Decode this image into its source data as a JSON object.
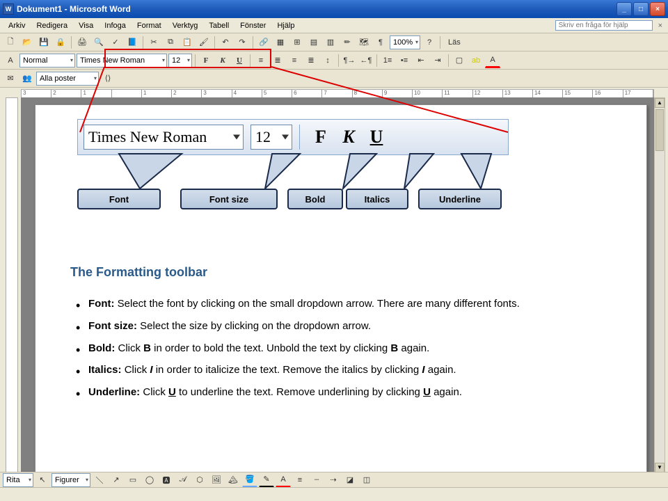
{
  "titlebar": {
    "title": "Dokument1 - Microsoft Word"
  },
  "menubar": {
    "items": [
      "Arkiv",
      "Redigera",
      "Visa",
      "Infoga",
      "Format",
      "Verktyg",
      "Tabell",
      "Fönster",
      "Hjälp"
    ],
    "help_placeholder": "Skriv en fråga för hjälp"
  },
  "toolbar_std": {
    "zoom": "100%",
    "read_label": "Läs"
  },
  "toolbar_fmt": {
    "style": "Normal",
    "font": "Times New Roman",
    "size": "12",
    "bold": "F",
    "italic": "K",
    "underline": "U"
  },
  "toolbar_mail": {
    "label": "Alla poster"
  },
  "ruler": {
    "marks": [
      "3",
      "2",
      "1",
      "",
      "1",
      "2",
      "3",
      "4",
      "5",
      "6",
      "7",
      "8",
      "9",
      "10",
      "11",
      "12",
      "13",
      "14",
      "15",
      "16",
      "17"
    ]
  },
  "enlarged": {
    "font": "Times New Roman",
    "size": "12",
    "bold": "F",
    "italic": "K",
    "underline": "U"
  },
  "callouts": {
    "font": "Font",
    "size": "Font size",
    "bold": "Bold",
    "italic": "Italics",
    "underline": "Underline"
  },
  "doc": {
    "heading": "The Formatting toolbar",
    "items": [
      {
        "term": "Font:",
        "text": " Select the font by clicking on the small dropdown arrow. There are many different fonts."
      },
      {
        "term": "Font size:",
        "text": " Select the size by clicking on the dropdown arrow."
      },
      {
        "term": "Bold:",
        "text": " Click B in order to bold the text. Unbold the text by clicking B again."
      },
      {
        "term": "Italics:",
        "text": " Click I in order to italicize the text. Remove the italics by clicking I again."
      },
      {
        "term": "Underline:",
        "text": " Click U to underline the text. Remove underlining by clicking U again."
      }
    ]
  },
  "drawbar": {
    "label": "Rita",
    "shapes": "Figurer"
  }
}
